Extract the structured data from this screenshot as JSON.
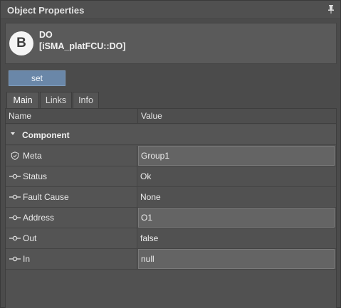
{
  "panel": {
    "title": "Object Properties"
  },
  "object": {
    "badge": "B",
    "name": "DO",
    "type": "[iSMA_platFCU::DO]"
  },
  "actions": {
    "set_label": "set"
  },
  "tabs": [
    {
      "label": "Main",
      "active": true
    },
    {
      "label": "Links",
      "active": false
    },
    {
      "label": "Info",
      "active": false
    }
  ],
  "table": {
    "columns": {
      "name": "Name",
      "value": "Value"
    },
    "section": "Component",
    "rows": [
      {
        "name": "Meta",
        "value": "Group1",
        "icon": "shield-icon",
        "editable": true
      },
      {
        "name": "Status",
        "value": "Ok",
        "icon": "slot-icon",
        "editable": false
      },
      {
        "name": "Fault Cause",
        "value": "None",
        "icon": "slot-icon",
        "editable": false
      },
      {
        "name": "Address",
        "value": "O1",
        "icon": "slot-icon",
        "editable": true
      },
      {
        "name": "Out",
        "value": "false",
        "icon": "slot-icon",
        "editable": false
      },
      {
        "name": "In",
        "value": "null",
        "icon": "slot-icon",
        "editable": true
      }
    ]
  }
}
